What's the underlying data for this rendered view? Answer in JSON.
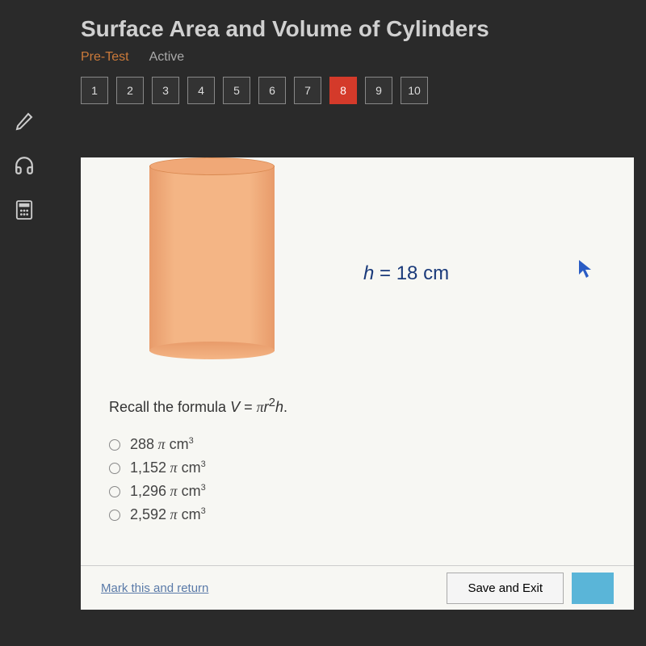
{
  "header": {
    "title": "Surface Area and Volume of Cylinders",
    "pretest": "Pre-Test",
    "active": "Active"
  },
  "nav": {
    "items": [
      "1",
      "2",
      "3",
      "4",
      "5",
      "6",
      "7",
      "8",
      "9",
      "10"
    ],
    "current": "8"
  },
  "figure": {
    "height_label": "h = 18 cm"
  },
  "formula": {
    "prefix": "Recall the formula ",
    "expr": "V = πr²h."
  },
  "options": [
    {
      "value": "288",
      "unit": "cm³"
    },
    {
      "value": "1,152",
      "unit": "cm³"
    },
    {
      "value": "1,296",
      "unit": "cm³"
    },
    {
      "value": "2,592",
      "unit": "cm³"
    }
  ],
  "footer": {
    "mark": "Mark this and return",
    "save": "Save and Exit"
  }
}
